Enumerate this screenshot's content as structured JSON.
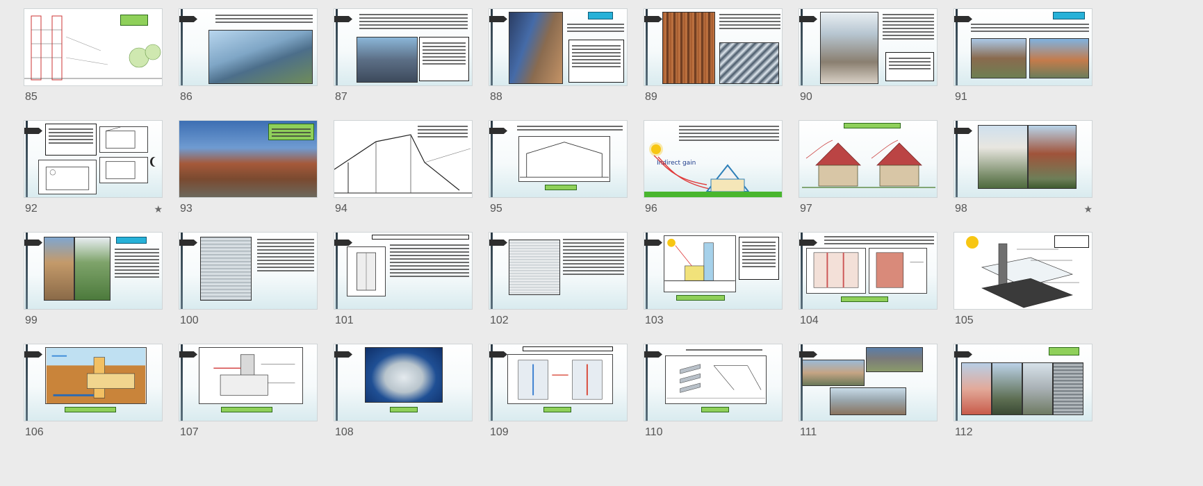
{
  "slides": [
    {
      "num": "85",
      "starred": false
    },
    {
      "num": "86",
      "starred": false
    },
    {
      "num": "87",
      "starred": false
    },
    {
      "num": "88",
      "starred": false
    },
    {
      "num": "89",
      "starred": false
    },
    {
      "num": "90",
      "starred": false
    },
    {
      "num": "91",
      "starred": false
    },
    {
      "num": "92",
      "starred": true
    },
    {
      "num": "93",
      "starred": false
    },
    {
      "num": "94",
      "starred": false
    },
    {
      "num": "95",
      "starred": false
    },
    {
      "num": "96",
      "starred": false
    },
    {
      "num": "97",
      "starred": false
    },
    {
      "num": "98",
      "starred": true
    },
    {
      "num": "99",
      "starred": false
    },
    {
      "num": "100",
      "starred": false
    },
    {
      "num": "101",
      "starred": false
    },
    {
      "num": "102",
      "starred": false
    },
    {
      "num": "103",
      "starred": false
    },
    {
      "num": "104",
      "starred": false
    },
    {
      "num": "105",
      "starred": false
    },
    {
      "num": "106",
      "starred": false
    },
    {
      "num": "107",
      "starred": false
    },
    {
      "num": "108",
      "starred": false
    },
    {
      "num": "109",
      "starred": false
    },
    {
      "num": "110",
      "starred": false
    },
    {
      "num": "111",
      "starred": false
    },
    {
      "num": "112",
      "starred": false
    }
  ],
  "star_glyph": "★",
  "slide_text": {
    "indirect_gain": "Indirect gain",
    "solar_sun": "sun-icon"
  },
  "colors": {
    "background": "#ebebeb",
    "label_accent": "#8fd05a",
    "title_accent": "#27b1d8"
  }
}
